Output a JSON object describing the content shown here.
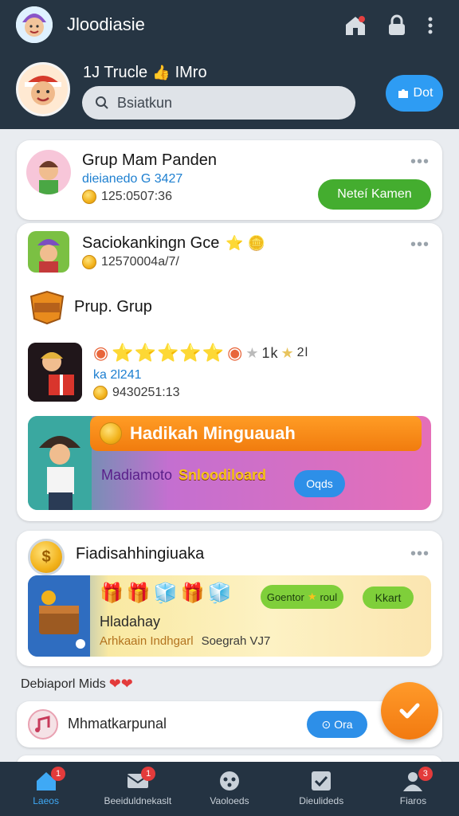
{
  "header": {
    "app_title": "Jloodiasie",
    "profile_name": "1J Trucle",
    "profile_name_suffix": "IMro",
    "profile_emoji": "👍",
    "dot_button_label": "Dot",
    "search": {
      "placeholder": "Bsiatkun"
    },
    "icons": [
      "home-icon",
      "lock-icon",
      "more-vertical-icon"
    ]
  },
  "card1": {
    "title": "Grup Mam Panden",
    "subtitle": "dieianedo G 3427",
    "coins": "125:0507:36",
    "button_label": "Neteí Kamen",
    "more": "•••"
  },
  "card2": {
    "title": "Saciokankingn Gce",
    "title_emojis": "⭐ 🪙",
    "coins": "12570004a/7/",
    "more": "•••",
    "group_badge": "Rocluce",
    "group_label": "Prup. Grup",
    "stars_row": "⭐⭐⭐⭐⭐",
    "stars_suffix": "1k",
    "stars_suffix2": "2l",
    "rating_text": "ka 2l241",
    "coins2": "9430251:13",
    "banner": {
      "title": "Hadikah Minguauah",
      "subtitle": "Madiamoto",
      "highlight": "Snloodiloard",
      "button_label": "Oqds"
    }
  },
  "card3": {
    "title": "Fiadisahhingiuaka",
    "more": "•••",
    "banner": {
      "tag": "Goentor",
      "tag2": "roul",
      "button_label": "Kkart",
      "label": "Hladahay",
      "footer_left": "Arhkaain Indhgarl",
      "footer_right": "Soegrah VJ7"
    }
  },
  "section_label": "Debiaporl Mids",
  "section_hearts": "❤❤",
  "list_item": {
    "text": "Mhmatkarpunal",
    "button_label": "Ora"
  },
  "nav": [
    {
      "label": "Laeos",
      "badge": "1",
      "icon": "home-icon"
    },
    {
      "label": "Beeiduldnekaslt",
      "badge": "1",
      "icon": "mail-icon"
    },
    {
      "label": "Vaoloeds",
      "badge": "",
      "icon": "game-icon"
    },
    {
      "label": "Dieulideds",
      "badge": "",
      "icon": "checkbox-icon"
    },
    {
      "label": "Fiaros",
      "badge": "3",
      "icon": "profile-icon"
    }
  ],
  "colors": {
    "header_bg": "#263543",
    "accent_blue": "#2e9cf3",
    "accent_green": "#44ad2f",
    "accent_orange": "#f27a10",
    "nav_bg": "#243342"
  }
}
